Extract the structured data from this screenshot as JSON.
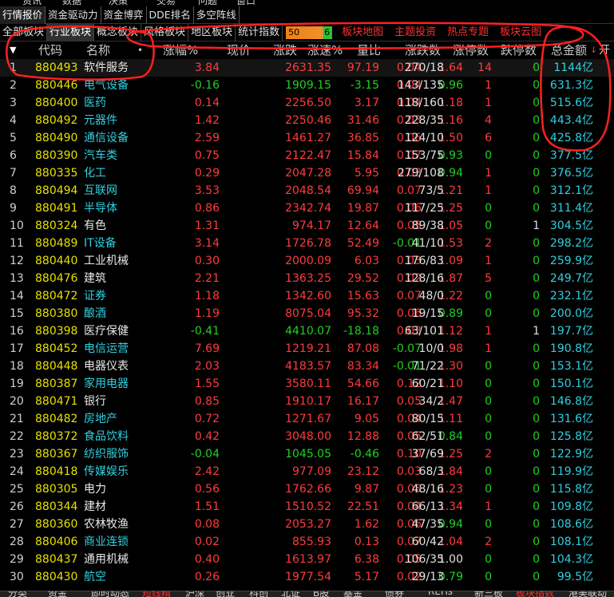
{
  "menu_top": [
    "资讯",
    "数据",
    "决策",
    "交易",
    "问题",
    "窗口"
  ],
  "tabs_row1": [
    "行情报价",
    "资金驱动力",
    "资金博弈",
    "DDE排名",
    "多空阵线"
  ],
  "tabs_row2": [
    "全部板块",
    "行业板块",
    "概念板块",
    "风格板块",
    "地区板块",
    "统计指数"
  ],
  "slider": {
    "low": "50",
    "high": "6"
  },
  "links_row2": [
    "板块地图",
    "主题投资",
    "热点专题",
    "板块云图"
  ],
  "header": {
    "code": "代码",
    "name": "名称",
    "pct": "涨幅%",
    "price": "现价",
    "chg": "涨跌",
    "speed": "涨速%",
    "ratio": "量比",
    "updown": "涨跌数",
    "ups": "涨停数",
    "downs": "跌停数",
    "amount": "总金额",
    "extra": "开"
  },
  "rows": [
    {
      "i": "1",
      "code": "880493",
      "name": "软件服务",
      "pct": "3.84",
      "price": "2631.35",
      "chg": "97.19",
      "speed": "0.04",
      "ratio": "1.64",
      "updown": "270/18",
      "ups": "14",
      "downs": "0",
      "amt": "1144亿",
      "nc": "up",
      "pc": "up",
      "sc": "up",
      "rc": "up"
    },
    {
      "i": "2",
      "code": "880446",
      "name": "电气设备",
      "pct": "-0.16",
      "price": "1909.15",
      "chg": "-3.15",
      "speed": "0.04",
      "ratio": "0.96",
      "updown": "143/135",
      "ups": "1",
      "downs": "0",
      "amt": "631.3亿",
      "nc": "cyan",
      "pc": "dn",
      "sc": "up",
      "rc": "dn"
    },
    {
      "i": "3",
      "code": "880400",
      "name": "医药",
      "pct": "0.14",
      "price": "2256.50",
      "chg": "3.17",
      "speed": "0.04",
      "ratio": "1.18",
      "updown": "118/160",
      "ups": "1",
      "downs": "0",
      "amt": "515.6亿",
      "nc": "cyan",
      "pc": "up",
      "sc": "up",
      "rc": "up"
    },
    {
      "i": "4",
      "code": "880492",
      "name": "元器件",
      "pct": "1.42",
      "price": "2250.46",
      "chg": "31.46",
      "speed": "0.03",
      "ratio": "1.16",
      "updown": "228/35",
      "ups": "4",
      "downs": "0",
      "amt": "443.4亿",
      "nc": "cyan",
      "pc": "up",
      "sc": "up",
      "rc": "up"
    },
    {
      "i": "5",
      "code": "880490",
      "name": "通信设备",
      "pct": "2.59",
      "price": "1461.27",
      "chg": "36.85",
      "speed": "0.06",
      "ratio": "1.50",
      "updown": "124/10",
      "ups": "6",
      "downs": "0",
      "amt": "425.8亿",
      "nc": "cyan",
      "pc": "up",
      "sc": "up",
      "rc": "up"
    },
    {
      "i": "6",
      "code": "880390",
      "name": "汽车类",
      "pct": "0.75",
      "price": "2122.47",
      "chg": "15.84",
      "speed": "0.07",
      "ratio": "0.93",
      "updown": "153/75",
      "ups": "0",
      "downs": "0",
      "amt": "377.5亿",
      "nc": "cyan",
      "pc": "up",
      "sc": "up",
      "rc": "dn"
    },
    {
      "i": "7",
      "code": "880335",
      "name": "化工",
      "pct": "0.29",
      "price": "2047.28",
      "chg": "5.95",
      "speed": "0.03",
      "ratio": "0.94",
      "updown": "279/108",
      "ups": "1",
      "downs": "0",
      "amt": "376.5亿",
      "nc": "cyan",
      "pc": "up",
      "sc": "up",
      "rc": "dn"
    },
    {
      "i": "8",
      "code": "880494",
      "name": "互联网",
      "pct": "3.53",
      "price": "2048.54",
      "chg": "69.94",
      "speed": "0.07",
      "ratio": "1.21",
      "updown": "73/5",
      "ups": "1",
      "downs": "0",
      "amt": "312.1亿",
      "nc": "cyan",
      "pc": "up",
      "sc": "up",
      "rc": "up"
    },
    {
      "i": "9",
      "code": "880491",
      "name": "半导体",
      "pct": "0.86",
      "price": "2342.74",
      "chg": "19.87",
      "speed": "0.06",
      "ratio": "1.25",
      "updown": "117/25",
      "ups": "0",
      "downs": "0",
      "amt": "311.4亿",
      "nc": "cyan",
      "pc": "up",
      "sc": "up",
      "rc": "up"
    },
    {
      "i": "10",
      "code": "880324",
      "name": "有色",
      "pct": "1.31",
      "price": "974.17",
      "chg": "12.64",
      "speed": "0.05",
      "ratio": "1.05",
      "updown": "89/38",
      "ups": "0",
      "downs": "1",
      "amt": "304.5亿",
      "nc": "white",
      "pc": "up",
      "sc": "up",
      "rc": "up"
    },
    {
      "i": "11",
      "code": "880489",
      "name": "IT设备",
      "pct": "3.14",
      "price": "1726.78",
      "chg": "52.49",
      "speed": "-0.01",
      "ratio": "1.53",
      "updown": "41/10",
      "ups": "2",
      "downs": "0",
      "amt": "298.2亿",
      "nc": "cyan",
      "pc": "up",
      "sc": "dn",
      "rc": "up"
    },
    {
      "i": "12",
      "code": "880440",
      "name": "工业机械",
      "pct": "0.30",
      "price": "2000.09",
      "chg": "6.03",
      "speed": "0.03",
      "ratio": "1.09",
      "updown": "176/83",
      "ups": "1",
      "downs": "0",
      "amt": "259.9亿",
      "nc": "white",
      "pc": "up",
      "sc": "up",
      "rc": "up"
    },
    {
      "i": "13",
      "code": "880476",
      "name": "建筑",
      "pct": "2.21",
      "price": "1363.25",
      "chg": "29.52",
      "speed": "0.02",
      "ratio": "1.87",
      "updown": "128/16",
      "ups": "5",
      "downs": "0",
      "amt": "249.7亿",
      "nc": "white",
      "pc": "up",
      "sc": "up",
      "rc": "up"
    },
    {
      "i": "14",
      "code": "880472",
      "name": "证券",
      "pct": "1.18",
      "price": "1342.60",
      "chg": "15.63",
      "speed": "0.07",
      "ratio": "1.22",
      "updown": "48/0",
      "ups": "0",
      "downs": "0",
      "amt": "232.1亿",
      "nc": "cyan",
      "pc": "up",
      "sc": "up",
      "rc": "up"
    },
    {
      "i": "15",
      "code": "880380",
      "name": "酿酒",
      "pct": "1.19",
      "price": "8075.04",
      "chg": "95.32",
      "speed": "0.06",
      "ratio": "0.89",
      "updown": "19/15",
      "ups": "0",
      "downs": "0",
      "amt": "200.0亿",
      "nc": "cyan",
      "pc": "up",
      "sc": "up",
      "rc": "dn"
    },
    {
      "i": "16",
      "code": "880398",
      "name": "医疗保健",
      "pct": "-0.41",
      "price": "4410.07",
      "chg": "-18.18",
      "speed": "0.03",
      "ratio": "1.12",
      "updown": "63/101",
      "ups": "1",
      "downs": "1",
      "amt": "197.7亿",
      "nc": "white",
      "pc": "dn",
      "sc": "up",
      "rc": "up"
    },
    {
      "i": "17",
      "code": "880452",
      "name": "电信运营",
      "pct": "7.69",
      "price": "1219.21",
      "chg": "87.08",
      "speed": "-0.07",
      "ratio": "1.98",
      "updown": "10/0",
      "ups": "1",
      "downs": "0",
      "amt": "190.8亿",
      "nc": "cyan",
      "pc": "up",
      "sc": "dn",
      "rc": "up"
    },
    {
      "i": "18",
      "code": "880448",
      "name": "电器仪表",
      "pct": "2.03",
      "price": "4183.57",
      "chg": "83.34",
      "speed": "-0.01",
      "ratio": "1.30",
      "updown": "71/22",
      "ups": "0",
      "downs": "0",
      "amt": "153.1亿",
      "nc": "white",
      "pc": "up",
      "sc": "dn",
      "rc": "up"
    },
    {
      "i": "19",
      "code": "880387",
      "name": "家用电器",
      "pct": "1.55",
      "price": "3580.11",
      "chg": "54.66",
      "speed": "0.12",
      "ratio": "1.10",
      "updown": "60/21",
      "ups": "0",
      "downs": "0",
      "amt": "150.1亿",
      "nc": "cyan",
      "pc": "up",
      "sc": "up",
      "rc": "up"
    },
    {
      "i": "20",
      "code": "880471",
      "name": "银行",
      "pct": "0.85",
      "price": "1910.17",
      "chg": "16.17",
      "speed": "0.05",
      "ratio": "1.47",
      "updown": "34/2",
      "ups": "0",
      "downs": "0",
      "amt": "146.8亿",
      "nc": "white",
      "pc": "up",
      "sc": "up",
      "rc": "up"
    },
    {
      "i": "21",
      "code": "880482",
      "name": "房地产",
      "pct": "0.72",
      "price": "1271.67",
      "chg": "9.05",
      "speed": "0.04",
      "ratio": "1.11",
      "updown": "80/15",
      "ups": "0",
      "downs": "0",
      "amt": "131.6亿",
      "nc": "cyan",
      "pc": "up",
      "sc": "up",
      "rc": "up"
    },
    {
      "i": "22",
      "code": "880372",
      "name": "食品饮料",
      "pct": "0.42",
      "price": "3048.00",
      "chg": "12.88",
      "speed": "0.05",
      "ratio": "0.84",
      "updown": "62/51",
      "ups": "0",
      "downs": "0",
      "amt": "125.8亿",
      "nc": "cyan",
      "pc": "up",
      "sc": "up",
      "rc": "dn"
    },
    {
      "i": "23",
      "code": "880367",
      "name": "纺织服饰",
      "pct": "-0.04",
      "price": "1045.05",
      "chg": "-0.46",
      "speed": "0.10",
      "ratio": "1.25",
      "updown": "37/69",
      "ups": "2",
      "downs": "0",
      "amt": "122.9亿",
      "nc": "cyan",
      "pc": "dn",
      "sc": "up",
      "rc": "up"
    },
    {
      "i": "24",
      "code": "880418",
      "name": "传媒娱乐",
      "pct": "2.42",
      "price": "977.09",
      "chg": "23.12",
      "speed": "0.03",
      "ratio": "1.84",
      "updown": "68/3",
      "ups": "0",
      "downs": "0",
      "amt": "119.9亿",
      "nc": "cyan",
      "pc": "up",
      "sc": "up",
      "rc": "up"
    },
    {
      "i": "25",
      "code": "880305",
      "name": "电力",
      "pct": "0.56",
      "price": "1762.66",
      "chg": "9.87",
      "speed": "0.05",
      "ratio": "1.23",
      "updown": "48/16",
      "ups": "0",
      "downs": "0",
      "amt": "115.8亿",
      "nc": "white",
      "pc": "up",
      "sc": "up",
      "rc": "up"
    },
    {
      "i": "26",
      "code": "880344",
      "name": "建材",
      "pct": "1.51",
      "price": "1510.52",
      "chg": "22.51",
      "speed": "0.04",
      "ratio": "1.34",
      "updown": "66/13",
      "ups": "1",
      "downs": "0",
      "amt": "109.8亿",
      "nc": "white",
      "pc": "up",
      "sc": "up",
      "rc": "up"
    },
    {
      "i": "27",
      "code": "880360",
      "name": "农林牧渔",
      "pct": "0.08",
      "price": "2053.27",
      "chg": "1.62",
      "speed": "0.06",
      "ratio": "0.94",
      "updown": "47/35",
      "ups": "0",
      "downs": "0",
      "amt": "108.6亿",
      "nc": "white",
      "pc": "up",
      "sc": "up",
      "rc": "dn"
    },
    {
      "i": "28",
      "code": "880406",
      "name": "商业连锁",
      "pct": "0.02",
      "price": "855.93",
      "chg": "0.13",
      "speed": "0.07",
      "ratio": "1.04",
      "updown": "60/42",
      "ups": "2",
      "downs": "0",
      "amt": "108.1亿",
      "nc": "cyan",
      "pc": "up",
      "sc": "up",
      "rc": "up"
    },
    {
      "i": "29",
      "code": "880437",
      "name": "通用机械",
      "pct": "0.40",
      "price": "1613.97",
      "chg": "6.38",
      "speed": "0.05",
      "ratio": "1.00",
      "updown": "106/35",
      "ups": "0",
      "downs": "0",
      "amt": "104.3亿",
      "nc": "white",
      "pc": "up",
      "sc": "up",
      "rc": "flat"
    },
    {
      "i": "30",
      "code": "880430",
      "name": "航空",
      "pct": "0.26",
      "price": "1977.54",
      "chg": "5.17",
      "speed": "0.02",
      "ratio": "0.79",
      "updown": "29/13",
      "ups": "0",
      "downs": "0",
      "amt": "99.5亿",
      "nc": "cyan",
      "pc": "up",
      "sc": "up",
      "rc": "dn"
    }
  ],
  "bottom_tabs": [
    "分类",
    "资金",
    "即时动态",
    "短线精",
    "沪深",
    "创业",
    "科创",
    "北证",
    "B股",
    "基金",
    "债券",
    "REITs",
    "新三板",
    "板块指数",
    "港美联动"
  ]
}
